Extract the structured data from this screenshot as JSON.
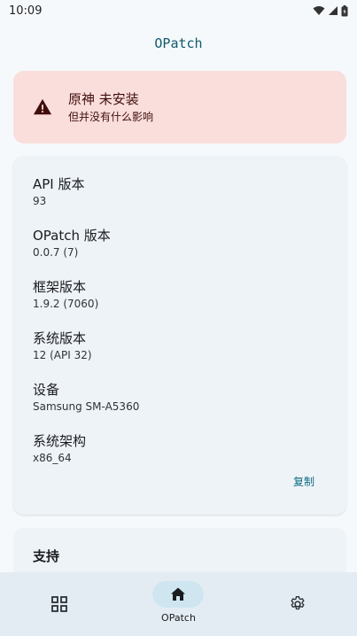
{
  "status_bar": {
    "time": "10:09"
  },
  "header": {
    "title": "OPatch"
  },
  "warning": {
    "title": "原神 未安装",
    "subtitle": "但并没有什么影响"
  },
  "info": {
    "items": [
      {
        "label": "API 版本",
        "value": "93"
      },
      {
        "label": "OPatch 版本",
        "value": "0.0.7 (7)"
      },
      {
        "label": "框架版本",
        "value": "1.9.2 (7060)"
      },
      {
        "label": "系统版本",
        "value": "12 (API 32)"
      },
      {
        "label": "设备",
        "value": "Samsung SM-A5360"
      },
      {
        "label": "系统架构",
        "value": "x86_64"
      }
    ],
    "copy_label": "复制"
  },
  "support": {
    "title": "支持"
  },
  "bottom_nav": {
    "items": [
      {
        "icon": "apps-grid-icon",
        "label": ""
      },
      {
        "icon": "home-icon",
        "label": "OPatch",
        "active": true
      },
      {
        "icon": "gear-icon",
        "label": ""
      }
    ]
  },
  "colors": {
    "accent": "#0f5a6b",
    "warning_bg": "#f9dedc",
    "card_bg": "#eef3f8",
    "nav_active": "#cfe6f1"
  }
}
